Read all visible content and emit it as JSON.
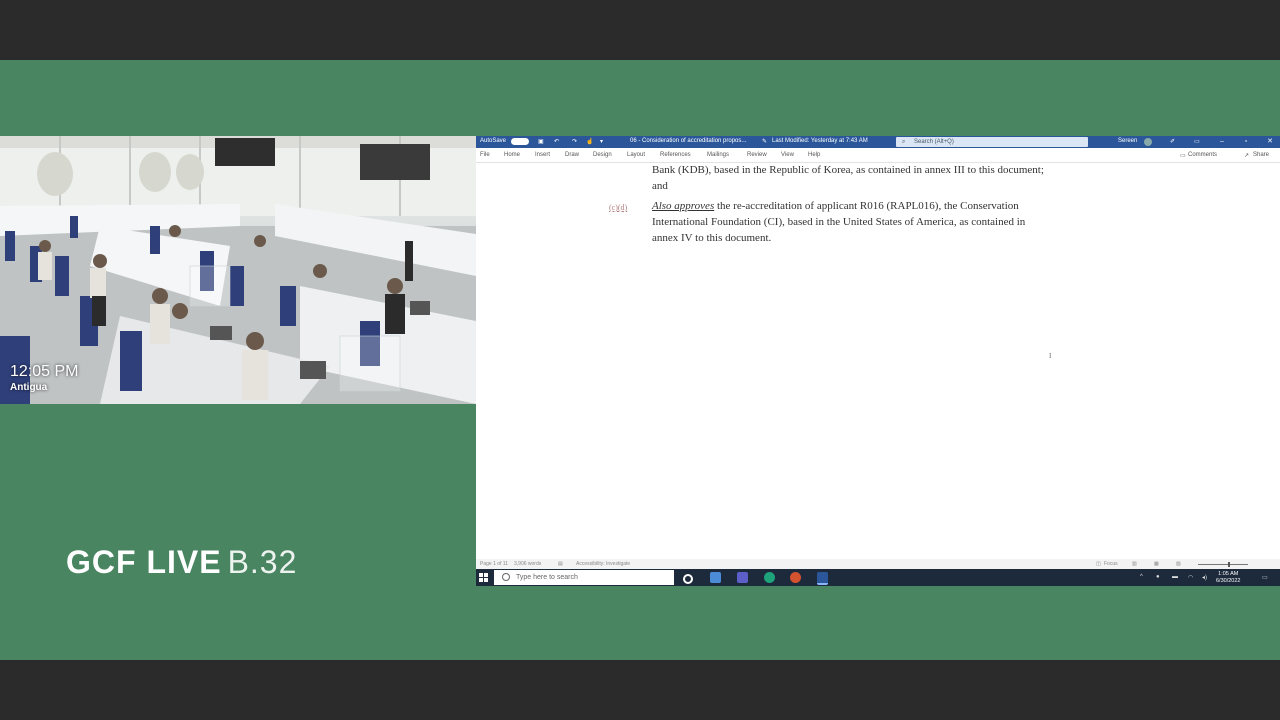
{
  "camera": {
    "time": "12:05 PM",
    "location": "Antigua"
  },
  "brand": {
    "main": "GCF LIVE",
    "session": "B.32"
  },
  "word": {
    "autosave_label": "AutoSave",
    "document_title": "06 - Consideration of accreditation propos...",
    "modified": "Last Modified: Yesterday at 7:43 AM",
    "search_placeholder": "Search (Alt+Q)",
    "user_name": "Sereen",
    "ribbon_tabs": [
      "File",
      "Home",
      "Insert",
      "Draw",
      "Design",
      "Layout",
      "References",
      "Mailings",
      "Review",
      "View",
      "Help"
    ],
    "comments_label": "Comments",
    "share_label": "Share",
    "doc_lines": {
      "line1": "Bank (KDB), based in the Republic of Korea, as contained in annex III to this document;",
      "line2": "and",
      "marker": "(c)(d)",
      "line3_italic": "Also approves",
      "line3_rest": " the re-accreditation of applicant R016 (RAPL016), the Conservation",
      "line4": "International Foundation (CI), based in the United States of America, as contained in",
      "line5": "annex IV to this document."
    },
    "status": {
      "page": "Page 1 of 11",
      "words": "3,906 words",
      "accessibility": "Accessibility: Investigate",
      "focus": "Focus"
    }
  },
  "taskbar": {
    "search_placeholder": "Type here to search",
    "time": "1:05 AM",
    "date": "6/30/2022"
  },
  "colors": {
    "stage": "#4a8562",
    "word_blue": "#2b579a",
    "taskbar": "#1c2a3c"
  }
}
